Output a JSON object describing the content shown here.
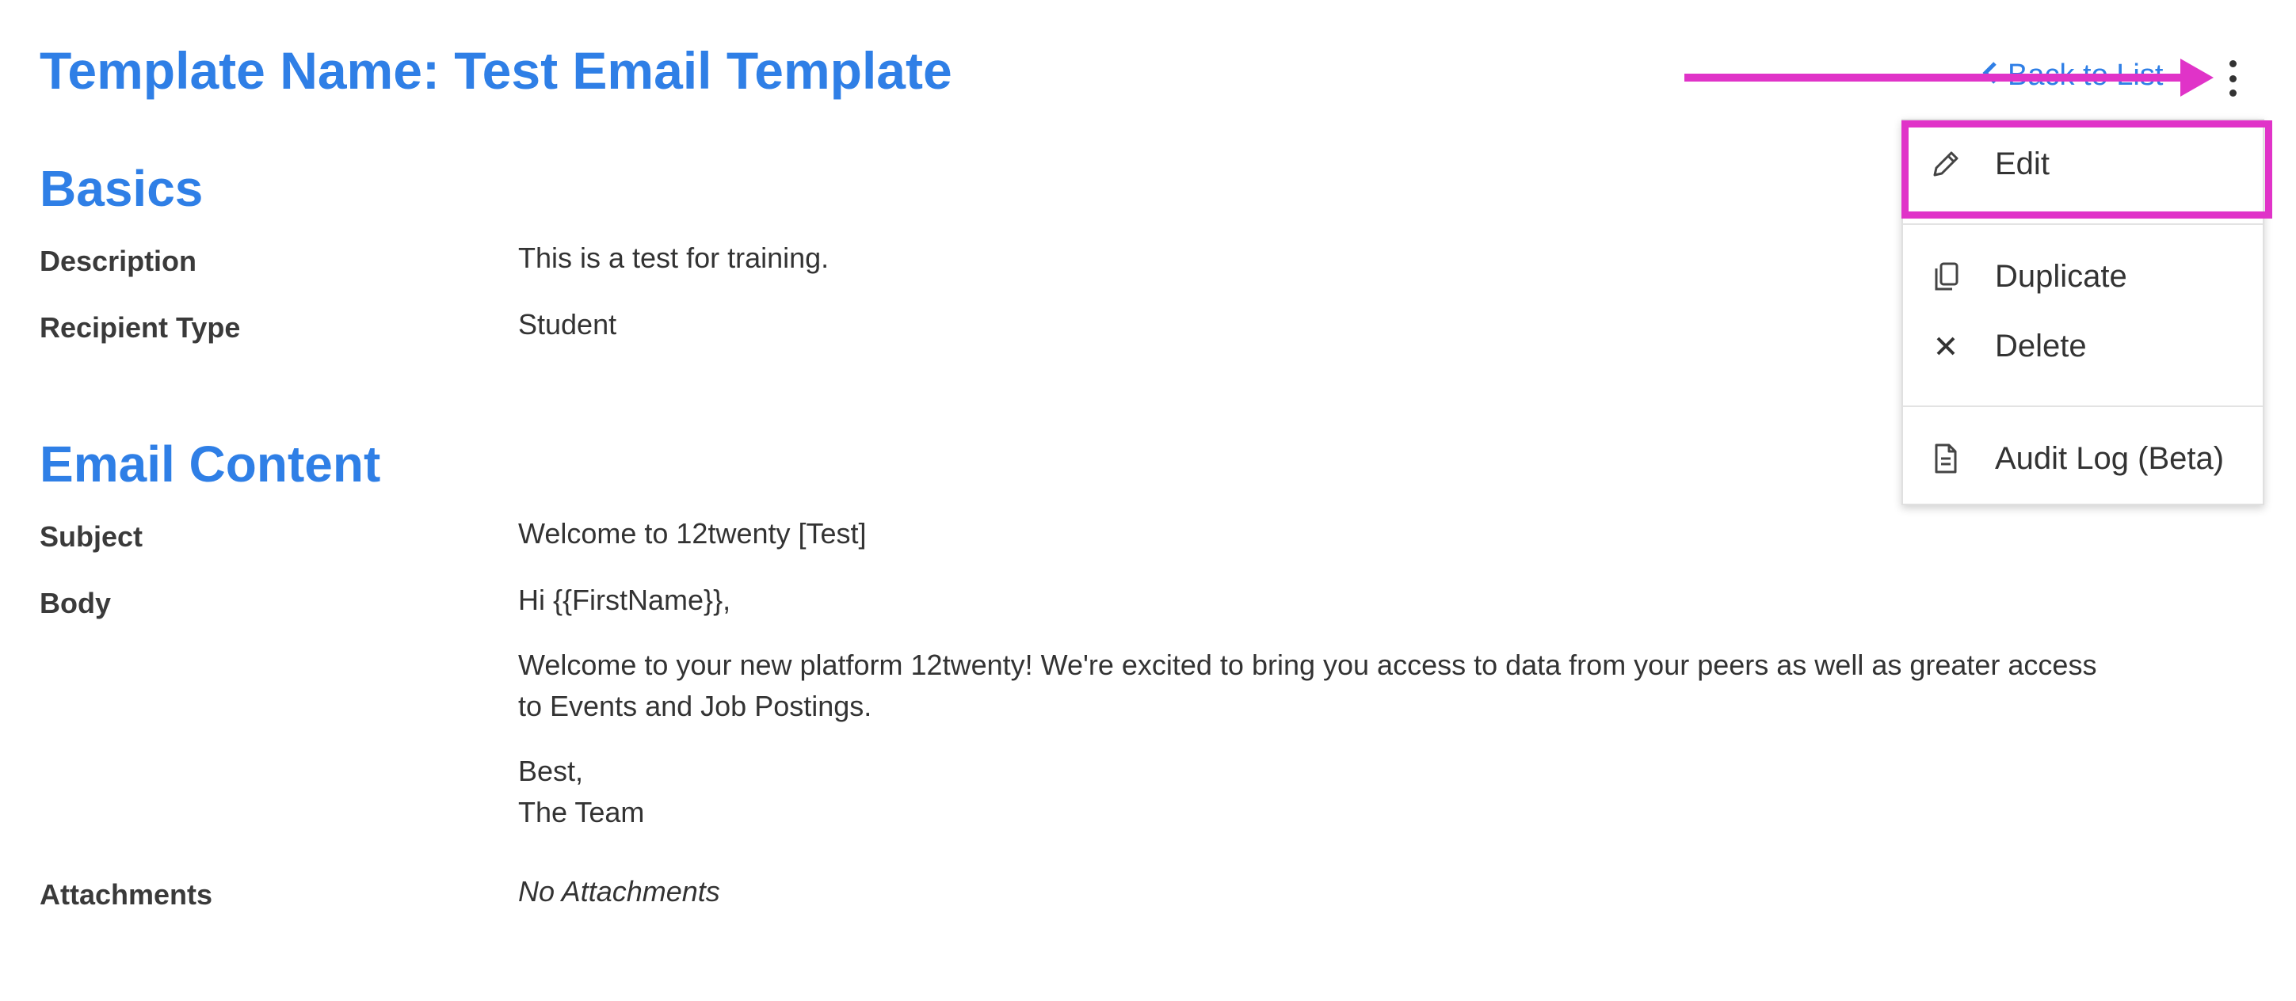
{
  "header": {
    "title": "Template Name: Test Email Template",
    "back_link": "Back to List"
  },
  "basics": {
    "heading": "Basics",
    "fields": [
      {
        "label": "Description",
        "value": "This is a test for training."
      },
      {
        "label": "Recipient Type",
        "value": "Student"
      }
    ]
  },
  "email_content": {
    "heading": "Email Content",
    "subject": {
      "label": "Subject",
      "value": "Welcome to 12twenty [Test]"
    },
    "body": {
      "label": "Body",
      "greeting": "Hi {{FirstName}},",
      "paragraph_line1": "Welcome to your new platform 12twenty! We're excited to bring you access to data from your peers as well as greater access",
      "paragraph_line2": "to Events and Job Postings.",
      "signoff": "Best,",
      "signature": "The Team"
    },
    "attachments": {
      "label": "Attachments",
      "value": "No Attachments"
    }
  },
  "actions_menu": {
    "items": [
      {
        "label": "Edit",
        "icon": "pencil-icon"
      },
      {
        "label": "Duplicate",
        "icon": "duplicate-icon"
      },
      {
        "label": "Delete",
        "icon": "close-icon"
      },
      {
        "label": "Audit Log (Beta)",
        "icon": "document-icon"
      }
    ]
  },
  "colors": {
    "heading_blue": "#2f7fe6",
    "annotation_magenta": "#e033c8"
  }
}
